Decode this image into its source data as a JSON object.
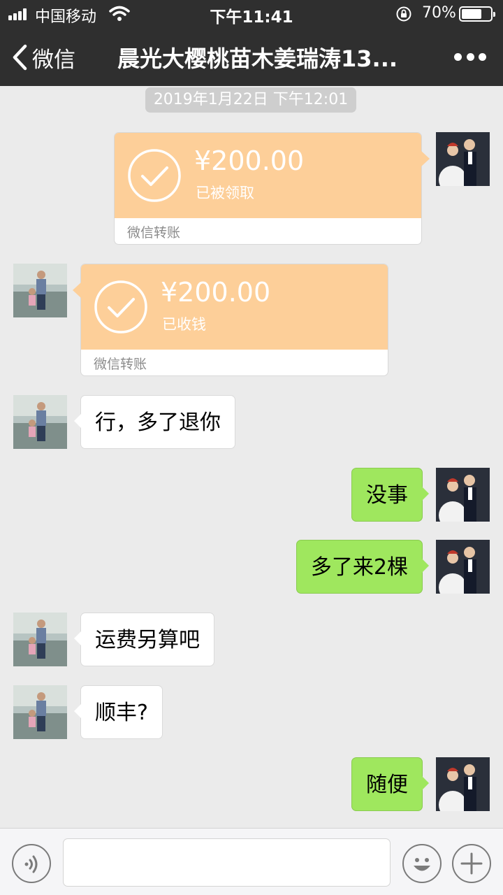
{
  "status_bar": {
    "carrier": "中国移动",
    "time": "下午11:41",
    "battery_percent": "70%",
    "battery_level": 0.7
  },
  "nav": {
    "back_label": "微信",
    "title": "晨光大樱桃苗木姜瑞涛13..."
  },
  "chat": {
    "timestamp": "2019年1月22日 下午12:01",
    "transfer_sent": {
      "amount": "¥200.00",
      "status": "已被领取",
      "footer": "微信转账"
    },
    "transfer_received": {
      "amount": "¥200.00",
      "status": "已收钱",
      "footer": "微信转账"
    },
    "messages": [
      {
        "from": "other",
        "text": "行，多了退你"
      },
      {
        "from": "me",
        "text": "没事"
      },
      {
        "from": "me",
        "text": "多了来2棵"
      },
      {
        "from": "other",
        "text": "运费另算吧"
      },
      {
        "from": "other",
        "text": "顺丰?"
      },
      {
        "from": "me",
        "text": "随便"
      }
    ]
  },
  "input_bar": {
    "message_value": "",
    "voice_icon": "voice-icon",
    "emoji_icon": "emoji-icon",
    "plus_icon": "plus-icon"
  },
  "colors": {
    "header_bg": "#2f2f2f",
    "chat_bg": "#ebebeb",
    "outgoing_bubble": "#9fe75e",
    "transfer_card": "#fdcf99"
  }
}
